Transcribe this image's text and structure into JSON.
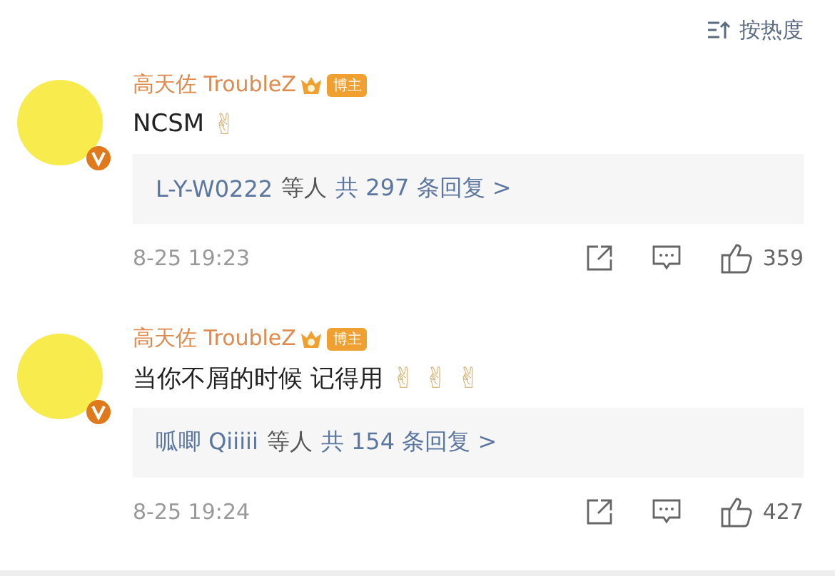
{
  "sort": {
    "label": "按热度"
  },
  "comments": [
    {
      "author": "高天佐 TroubleZ",
      "badge": "博主",
      "text": "NCSM",
      "emojis": [
        "✌"
      ],
      "replies": {
        "names": "L-Y-W0222",
        "suffix": "等人",
        "count": "共 297 条回复 >"
      },
      "time": "8-25 19:23",
      "likes": "359"
    },
    {
      "author": "高天佐 TroubleZ",
      "badge": "博主",
      "text": "当你不屑的时候 记得用",
      "emojis": [
        "✌",
        "✌",
        "✌"
      ],
      "replies": {
        "names": "呱唧 Qiiiii",
        "suffix": "等人",
        "count": "共 154 条回复 >"
      },
      "time": "8-25 19:24",
      "likes": "427"
    }
  ]
}
